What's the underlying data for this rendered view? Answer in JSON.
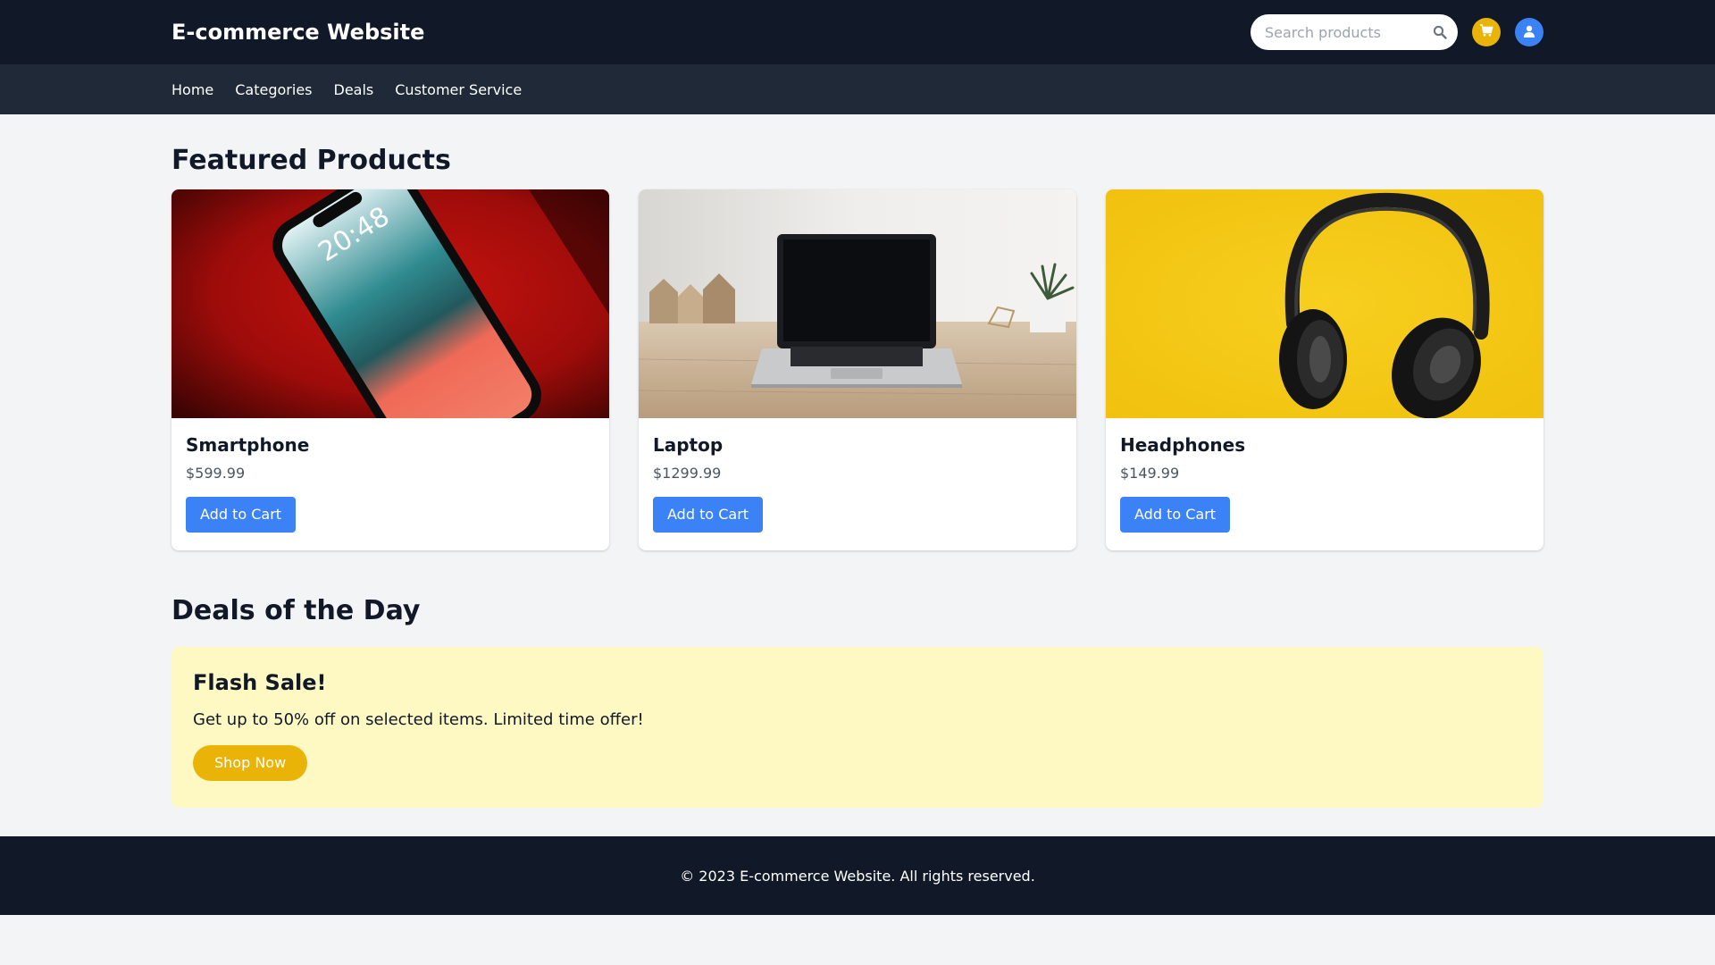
{
  "header": {
    "brand": "E-commerce Website",
    "search_placeholder": "Search products",
    "icons": {
      "search": "search-icon",
      "cart": "cart-icon",
      "user": "user-icon"
    }
  },
  "nav": {
    "items": [
      {
        "label": "Home"
      },
      {
        "label": "Categories"
      },
      {
        "label": "Deals"
      },
      {
        "label": "Customer Service"
      }
    ]
  },
  "featured": {
    "title": "Featured Products",
    "products": [
      {
        "name": "Smartphone",
        "price": "$599.99",
        "button": "Add to Cart",
        "image": "smartphone-photo"
      },
      {
        "name": "Laptop",
        "price": "$1299.99",
        "button": "Add to Cart",
        "image": "laptop-photo"
      },
      {
        "name": "Headphones",
        "price": "$149.99",
        "button": "Add to Cart",
        "image": "headphones-photo"
      }
    ]
  },
  "deals": {
    "title": "Deals of the Day",
    "banner_title": "Flash Sale!",
    "banner_text": "Get up to 50% off on selected items. Limited time offer!",
    "button": "Shop Now"
  },
  "footer": {
    "text": "© 2023 E-commerce Website. All rights reserved."
  },
  "colors": {
    "header_bg": "#111827",
    "nav_bg": "#1f2937",
    "primary": "#3b82f6",
    "accent": "#eab308",
    "banner_bg": "#fef9c3"
  }
}
